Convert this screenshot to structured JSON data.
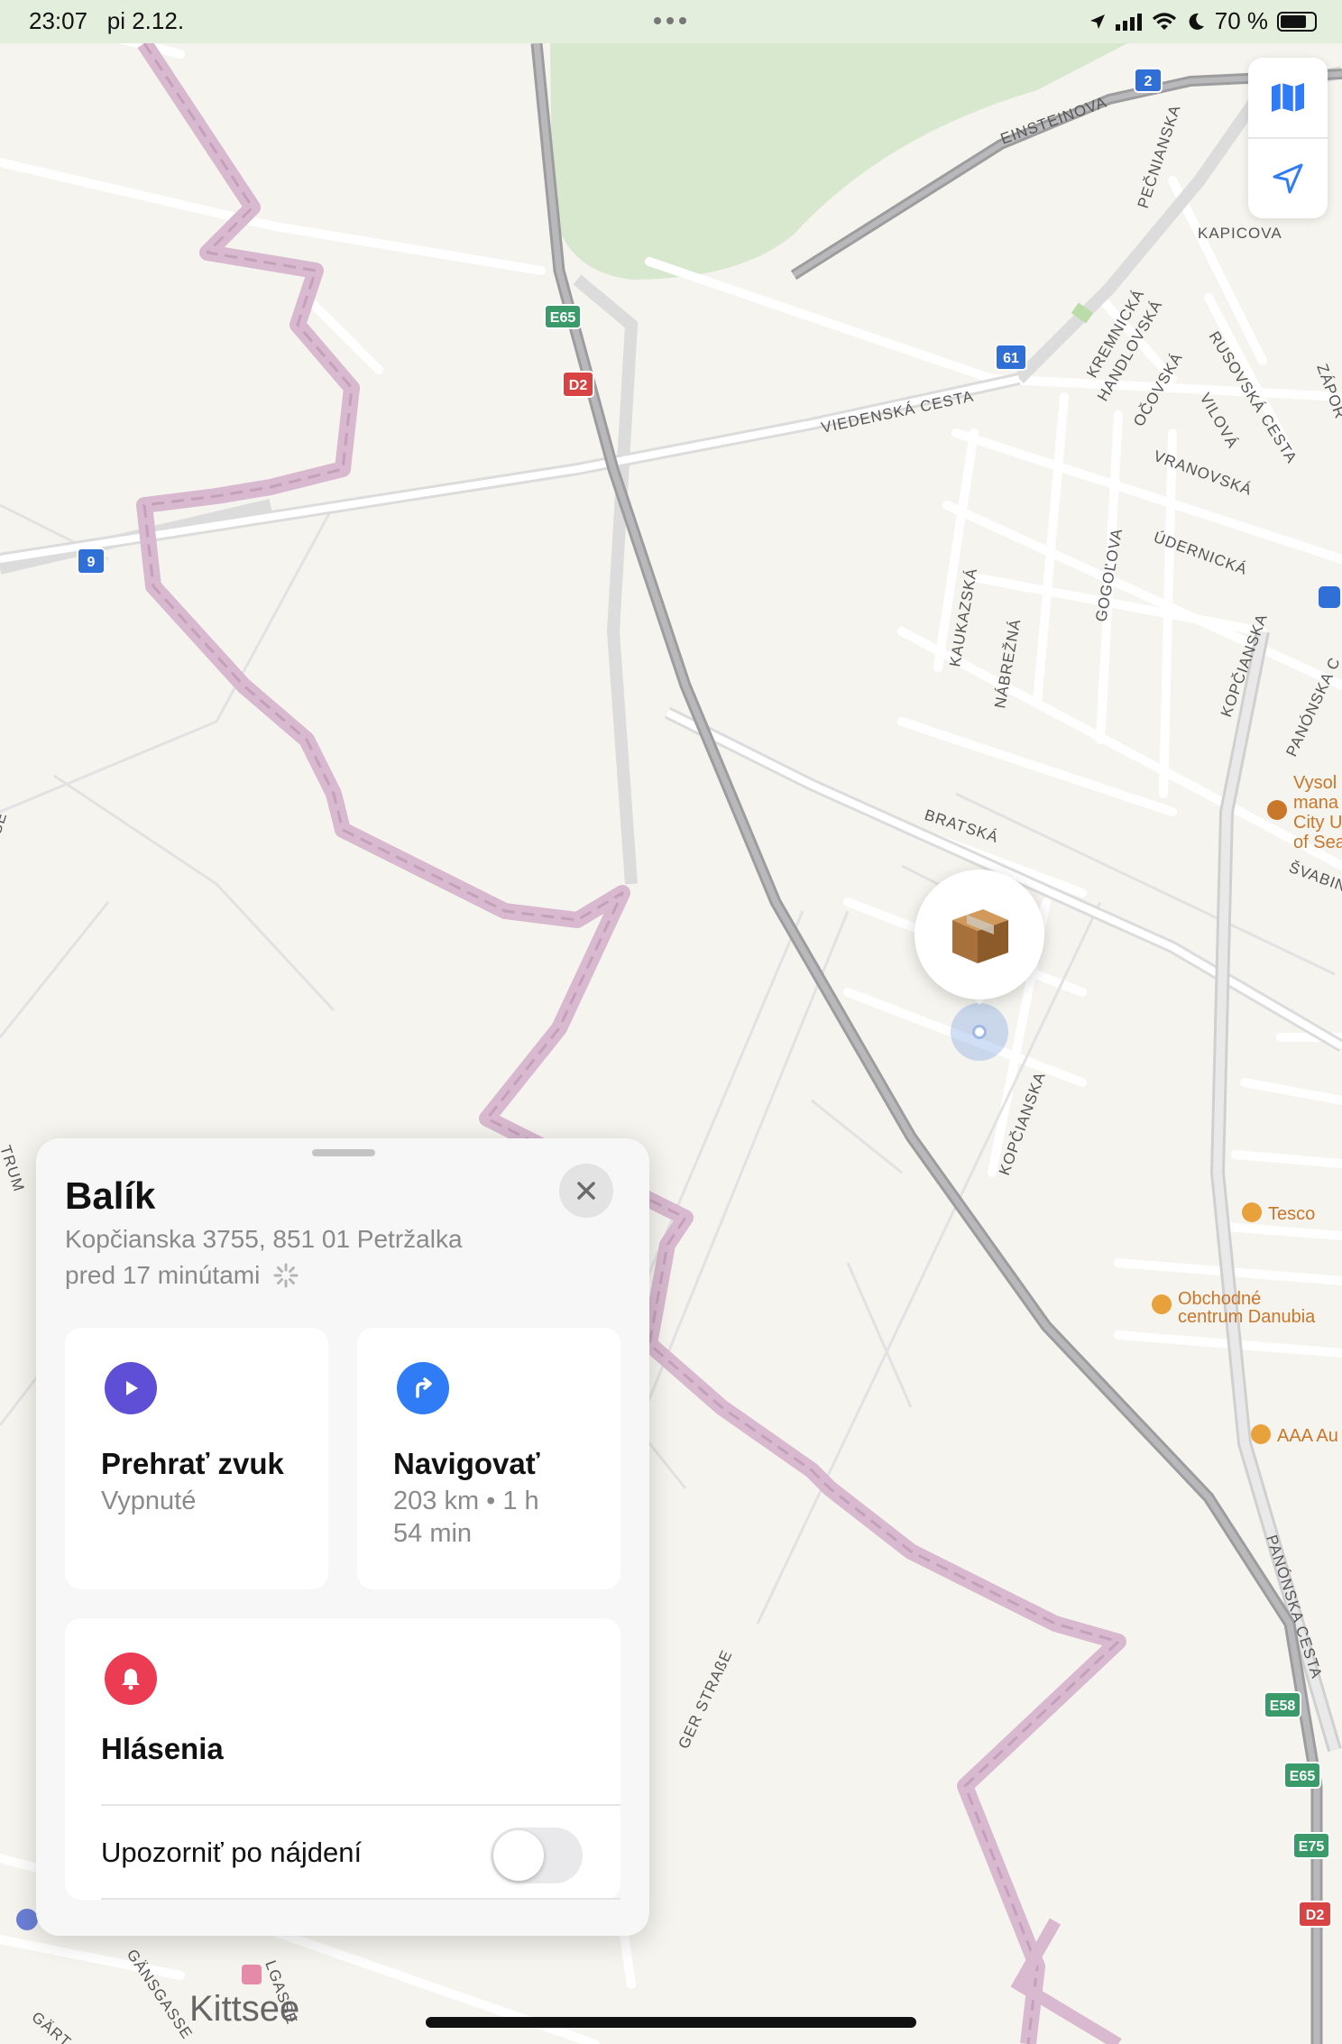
{
  "status_bar": {
    "time": "23:07",
    "date": "pi 2.12.",
    "battery": "70 %"
  },
  "map": {
    "streets": [
      "EINSTEINOVA",
      "VIEDENSKÁ CESTA",
      "BRATSKÁ",
      "PEČNIANSKA",
      "KAPICOVA",
      "KREMNICKÁ",
      "HANDLOVSKÁ",
      "RUSOVSKÁ CESTA",
      "OČOVSKÁ",
      "VILOVÁ",
      "VRANOVSKÁ",
      "ÚDERNICKÁ",
      "GOGOĽOVA",
      "KAUKAZSKÁ",
      "NÁBREŽNÁ",
      "KOPČIANSKA",
      "PANÓNSKA C",
      "ŠVABINS",
      "PANÓNSKA CESTA",
      "GER STRAßE",
      "GÄNSGASSE",
      "GÄRT",
      "LGASSE",
      "ZÁPOR",
      "TRUM",
      "SE"
    ],
    "kopcianska_lower": "KOPČIANSKA",
    "shields": [
      "2",
      "E65",
      "D2",
      "61",
      "9",
      "E58",
      "E65",
      "E75",
      "D2"
    ],
    "pois": [
      "Tesco",
      "Obchodné",
      "centrum Danubia",
      "AAA Au",
      "Vysol",
      "mana",
      "City U",
      "of Sea"
    ],
    "town": "Kittsee"
  },
  "panel": {
    "title": "Balík",
    "address": "Kopčianska 3755, 851 01 Petržalka",
    "updated": "pred 17 minútami",
    "play_sound": {
      "label": "Prehrať zvuk",
      "sub": "Vypnuté"
    },
    "navigate": {
      "label": "Navigovať",
      "sub1": "203 km • 1 h",
      "sub2": "54 min"
    },
    "notifications": {
      "label": "Hlásenia",
      "toggle_label": "Upozorniť po nájdení",
      "toggle_on": false
    }
  },
  "colors": {
    "accent_blue": "#2f7cf6",
    "play_purple": "#5e4fd6",
    "bell_red": "#ec3c53",
    "park_green": "#d7e8cf"
  }
}
